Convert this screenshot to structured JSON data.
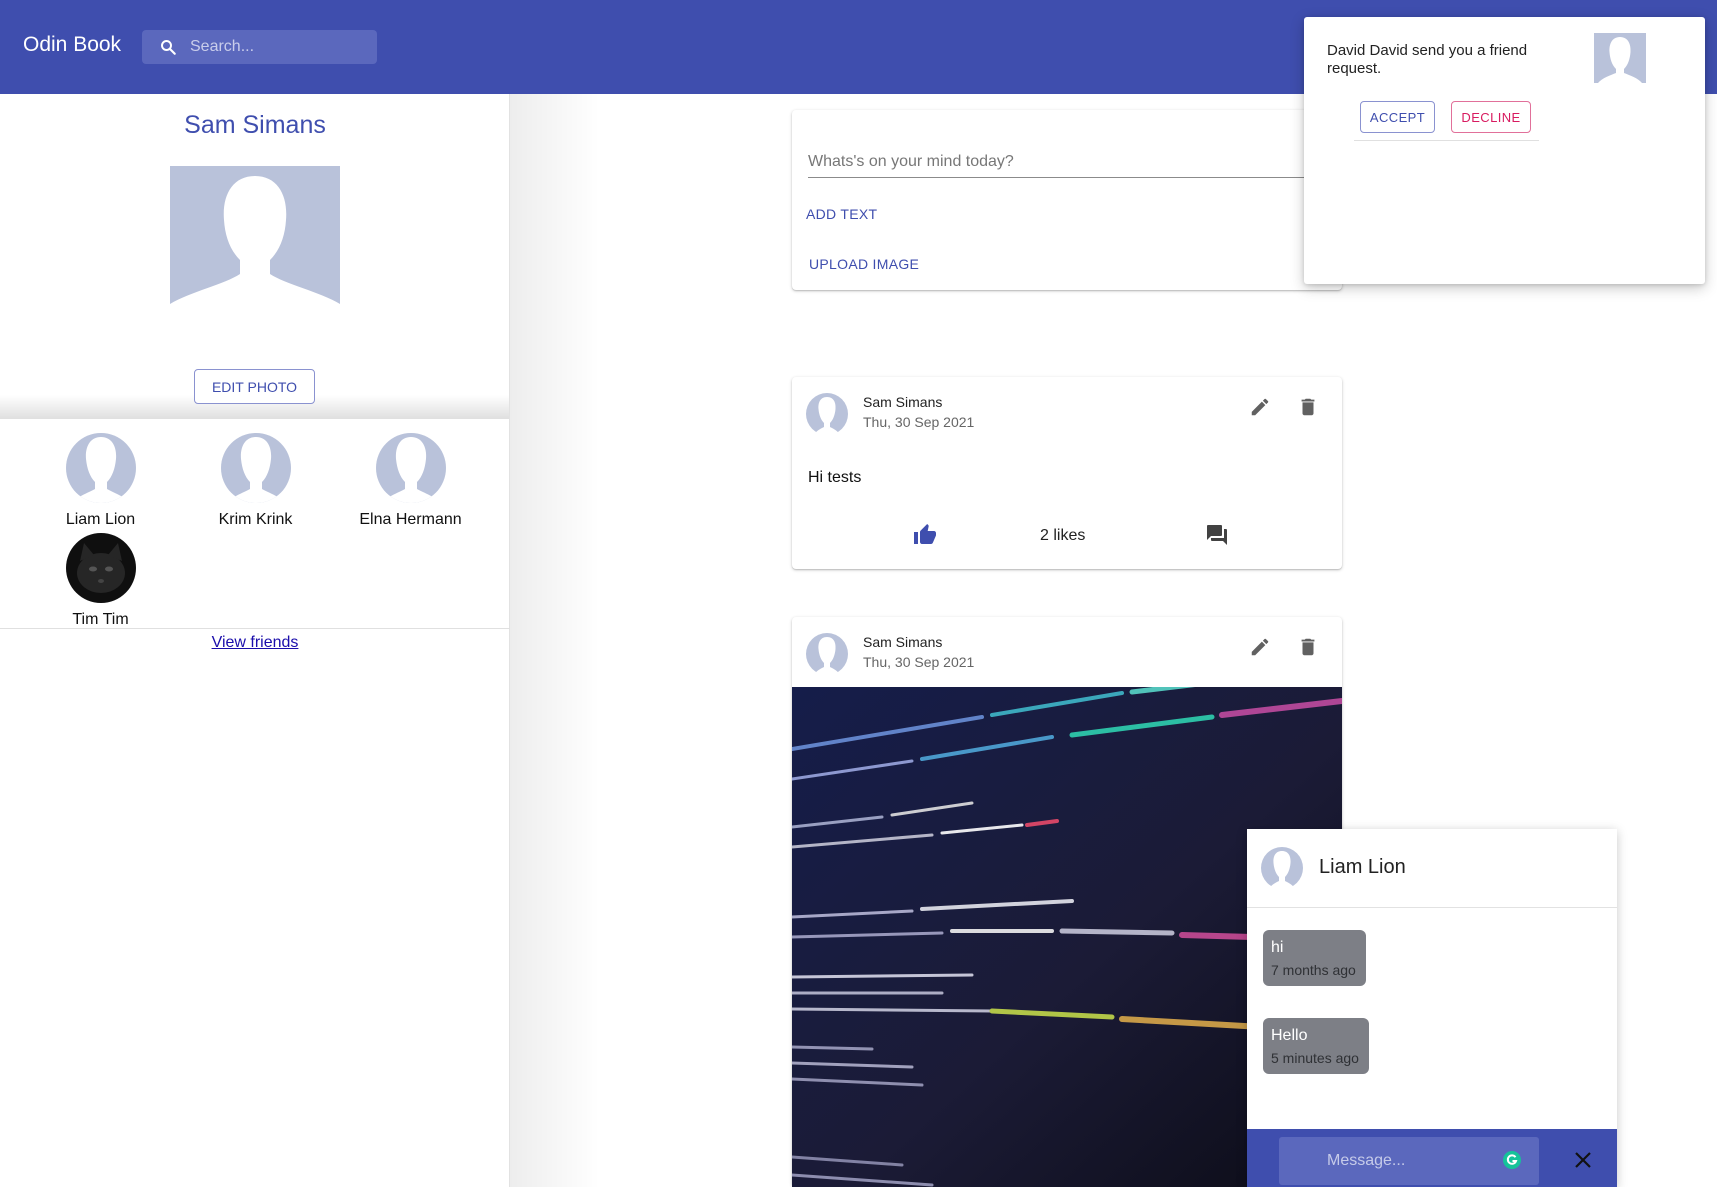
{
  "app": {
    "brand": "Odin Book",
    "search": {
      "placeholder": "Search..."
    }
  },
  "profile": {
    "name": "Sam Simans",
    "edit_photo_label": "EDIT PHOTO",
    "friends": [
      {
        "name": "Liam Lion",
        "avatar": "default-avatar-icon"
      },
      {
        "name": "Krim Krink",
        "avatar": "default-avatar-icon"
      },
      {
        "name": "Elna Hermann",
        "avatar": "default-avatar-icon"
      },
      {
        "name": "Tim Tim",
        "avatar": "dark-cat-photo"
      }
    ],
    "view_friends_label": "View friends"
  },
  "composer": {
    "placeholder": "Whats's on your mind today?",
    "add_text_label": "ADD TEXT",
    "upload_image_label": "UPLOAD IMAGE"
  },
  "posts": [
    {
      "author": "Sam Simans",
      "date": "Thu, 30 Sep 2021",
      "text": "Hi tests",
      "likes_label": "2 likes",
      "icons": [
        "edit-icon",
        "delete-icon",
        "thumb-up-icon",
        "comment-icon"
      ]
    },
    {
      "author": "Sam Simans",
      "date": "Thu, 30 Sep 2021",
      "image": "code-screen-photo",
      "icons": [
        "edit-icon",
        "delete-icon"
      ]
    }
  ],
  "notification": {
    "text": "David David send you a friend request.",
    "accept_label": "ACCEPT",
    "decline_label": "DECLINE"
  },
  "chat": {
    "contact_name": "Liam Lion",
    "messages": [
      {
        "text": "hi",
        "time": "7 months ago"
      },
      {
        "text": "Hello",
        "time": "5 minutes ago"
      }
    ],
    "input_placeholder": "Message..."
  },
  "colors": {
    "primary": "#3f4eae",
    "search_bg": "#5b68bd",
    "decline": "#d81b60",
    "avatar_placeholder": "#b9c2da",
    "bubble": "#7d7f86"
  }
}
